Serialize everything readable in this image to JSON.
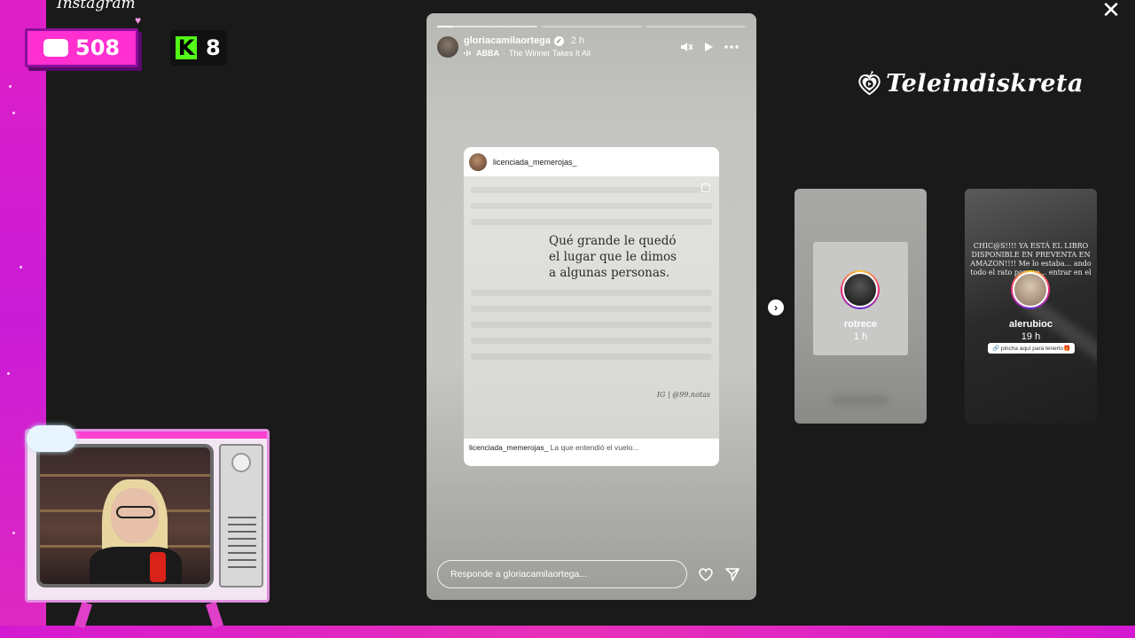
{
  "overlay": {
    "instagram_wordmark": "Instagram",
    "chat_count": "508",
    "kick_count": "8",
    "kick_letter": "K"
  },
  "logo": {
    "text": "Teleindiskreta",
    "color": "#ffffff"
  },
  "story": {
    "username": "gloriacamilaortega",
    "time": "2 h",
    "music_artist": "ABBA",
    "music_title": "The Winner Takes It All",
    "progress_segments": 3,
    "post": {
      "author": "licenciada_memerojas_",
      "quote_lines": [
        "Qué grande le quedó",
        "el lugar que le dimos",
        "a algunas personas."
      ],
      "credit": "IG | @99.notas",
      "caption_author": "licenciada_memerojas_",
      "caption_text": "La que entendió el vuelo..."
    },
    "reply_placeholder": "Responde a gloriacamilaortega..."
  },
  "previews": [
    {
      "username": "rotrece",
      "time": "1 h"
    },
    {
      "username": "alerubioc",
      "time": "19 h",
      "text": "CHIC@S!!!! YA ESTÁ EL LIBRO DISPONIBLE EN PREVENTA EN AMAZON!!!! Me lo estaba... ando todo el rato porque... entrar en el Os...",
      "link_label": "🔗 pincha aquí para tenerlo🎁"
    }
  ],
  "colors": {
    "frame_pink": "#e01fc6",
    "chat_bg": "#ff2fd0",
    "kick_green": "#53fc18"
  }
}
